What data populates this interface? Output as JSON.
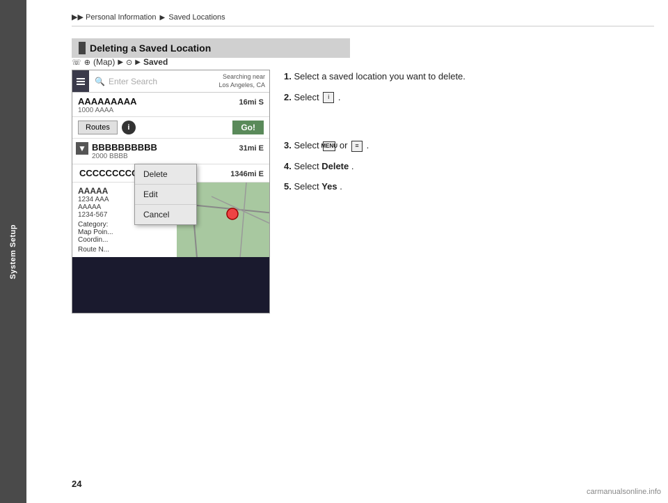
{
  "sidebar": {
    "label": "System Setup"
  },
  "breadcrumb": {
    "parts": [
      "▶▶",
      "Personal Information",
      "▶",
      "Saved Locations"
    ]
  },
  "section": {
    "title": "Deleting a Saved Location"
  },
  "nav_path": {
    "icons": [
      "phone",
      "map"
    ],
    "map_label": "(Map)",
    "arrows": [
      "▶",
      "▶",
      "▶"
    ],
    "saved_label": "Saved"
  },
  "nav_ui": {
    "search_placeholder": "Enter Search",
    "searching_near": "Searching near\nLos Angeles, CA",
    "item_a": {
      "name": "AAAAAAAAA",
      "sub": "1000 AAAA",
      "dist": "16",
      "unit": "mi",
      "letter": "S"
    },
    "routes_btn": "Routes",
    "go_btn": "Go!",
    "item_b": {
      "name": "BBBBBBBBBB",
      "sub": "2000 BBBB",
      "dist": "31",
      "unit": "mi",
      "letter": "E"
    },
    "item_c": {
      "name": "CCCCCCCCC",
      "sub": "",
      "dist": "1346",
      "unit": "mi",
      "letter": "E"
    },
    "context_menu": {
      "delete": "Delete",
      "edit": "Edit",
      "cancel": "Cancel"
    },
    "detail_a_name": "AAAAA",
    "detail_a_addr1": "1234 AAA",
    "detail_a_addr2": "AAAAA",
    "detail_a_addr3": "1234-567",
    "detail_category": "Category:",
    "detail_map_point": "Map Poin...",
    "detail_coords": "Coordin...",
    "detail_route": "Route N..."
  },
  "instructions": {
    "step1_num": "1.",
    "step1_text": "Select a saved location you want to delete.",
    "step2_num": "2.",
    "step2_pre": "Select ",
    "step2_icon": "i",
    "step2_post": ".",
    "step3_num": "3.",
    "step3_pre": "Select ",
    "step3_menu_icon": "MENU",
    "step3_or": " or ",
    "step3_icon2": "≡",
    "step3_post": ".",
    "step4_num": "4.",
    "step4_pre": "Select ",
    "step4_bold": "Delete",
    "step4_post": ".",
    "step5_num": "5.",
    "step5_pre": "Select ",
    "step5_bold": "Yes",
    "step5_post": "."
  },
  "page_number": "24",
  "watermark": "carmanualsonline.info"
}
